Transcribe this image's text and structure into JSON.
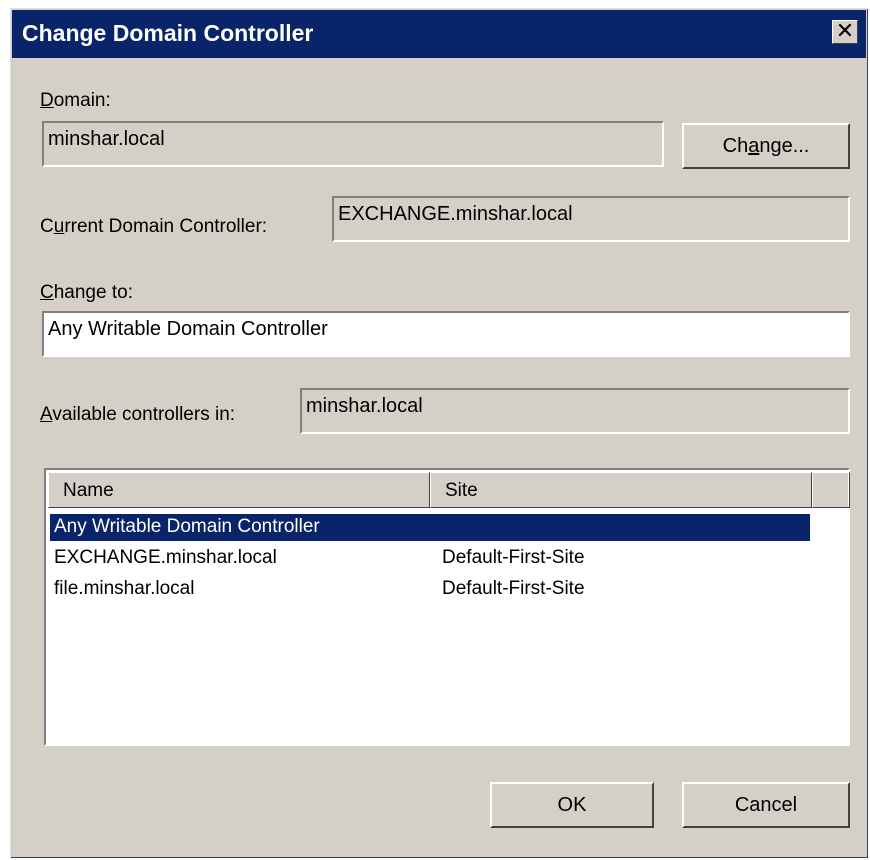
{
  "dialog": {
    "title": "Change Domain Controller",
    "close_glyph": "✕"
  },
  "domain": {
    "label": "Domain:",
    "value": "minshar.local",
    "change_button": "Change..."
  },
  "current_dc": {
    "label": "Current Domain Controller:",
    "value": "EXCHANGE.minshar.local"
  },
  "change_to": {
    "label": "Change to:",
    "value": "Any Writable Domain Controller"
  },
  "available_in": {
    "label": "Available controllers in:",
    "value": "minshar.local"
  },
  "controllers": {
    "columns": [
      "Name",
      "Site"
    ],
    "rows": [
      {
        "name": "Any Writable Domain Controller",
        "site": "",
        "selected": true
      },
      {
        "name": "EXCHANGE.minshar.local",
        "site": "Default-First-Site",
        "selected": false
      },
      {
        "name": "file.minshar.local",
        "site": "Default-First-Site",
        "selected": false
      }
    ]
  },
  "buttons": {
    "ok": "OK",
    "cancel": "Cancel"
  },
  "colors": {
    "titlebar": "#0a246a",
    "face": "#d4d0c8",
    "selection": "#0a246a"
  }
}
